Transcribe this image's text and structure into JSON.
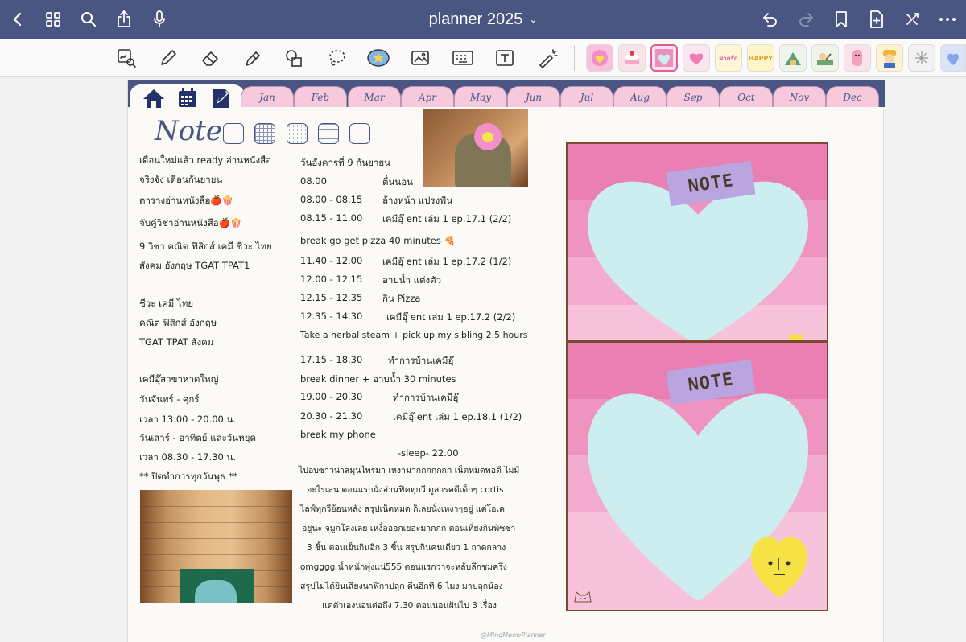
{
  "app": {
    "title": "planner 2025"
  },
  "colors": {
    "topbar": "#4a5682",
    "tab_pink": "#f6c9dd",
    "note_pink": "#e982b5",
    "heart_blue": "#cdeef0",
    "label_purple": "#b9a6e0"
  },
  "topbar": {
    "left_icons": [
      "back-icon",
      "grid-icon",
      "search-icon",
      "share-icon",
      "microphone-icon"
    ],
    "right_icons": [
      "undo-icon",
      "redo-icon",
      "bookmark-icon",
      "add-page-icon",
      "close-toolbar-icon",
      "more-icon"
    ]
  },
  "toolbar": {
    "tools": [
      "zoom-window-icon",
      "pen-icon",
      "eraser-icon",
      "highlighter-icon",
      "shapes-icon",
      "lasso-icon",
      "sticker-icon",
      "image-icon",
      "keyboard-icon",
      "text-box-icon",
      "laser-pointer-icon"
    ],
    "stickers": [
      "pink heart sticker",
      "cake sticker",
      "note card sticker",
      "heart sticker",
      "rak sticker",
      "happy sticker",
      "camping sticker",
      "picnic sticker",
      "bear sticker",
      "mascot sticker",
      "sparkle sticker",
      "blue heart sticker"
    ]
  },
  "tabs": {
    "months": [
      "Jan",
      "Feb",
      "Mar",
      "Apr",
      "May",
      "Jun",
      "Jul",
      "Aug",
      "Sep",
      "Oct",
      "Nov",
      "Dec"
    ],
    "home_icons": [
      "home-icon",
      "calendar-icon",
      "notebook-icon"
    ]
  },
  "note": {
    "heading": "Note",
    "templates": [
      "blank",
      "grid",
      "dotted",
      "grid",
      "lined",
      "blank"
    ]
  },
  "left_column": [
    "เดือนใหม่แล้ว ready อ่านหนังสือ",
    "จริงจัง เดือนกันยายน",
    "ตารางอ่านหนังสือ🍎🍿",
    "จับคู่วิชาอ่านหนังสือ🍎🍿",
    "9 วิชา คณิต ฟิสิกส์ เคมี ชีวะ ไทย",
    "สังคม อังกฤษ TGAT TPAT1",
    "",
    "ชีวะ เคมี ไทย",
    "คณิต ฟิสิกส์ อังกฤษ",
    "TGAT TPAT สังคม",
    "",
    "เคมีอุ๊สาขาหาดใหญ่",
    "วันจันทร์ - ศุกร์",
    "เวลา 13.00 - 20.00 น.",
    "วันเสาร์ - อาทิตย์ และวันหยุด",
    "เวลา 08.30 - 17.30 น.",
    "** ปิดทำการทุกวันพุธ **"
  ],
  "schedule": {
    "date": "วันอังคารที่ 9 กันยายน",
    "rows": [
      {
        "time": "08.00",
        "activity": "ตื่นนอน"
      },
      {
        "time": "08.00 - 08.15",
        "activity": "ล้างหน้า แปรงฟัน"
      },
      {
        "time": "08.15 - 11.00",
        "activity": "เคมีอุ๊ ent เล่ม 1 ep.17.1 (2/2)"
      },
      {
        "time": "",
        "activity": "break go get pizza  40 minutes 🍕"
      },
      {
        "time": "11.40 - 12.00",
        "activity": "เคมีอุ๊ ent เล่ม 1 ep.17.2 (1/2)"
      },
      {
        "time": "12.00 - 12.15",
        "activity": "อาบน้ำ แต่งตัว"
      },
      {
        "time": "12.15 - 12.35",
        "activity": "กิน Pizza"
      },
      {
        "time": "12.35 - 14.30",
        "activity": "เคมีอุ๊ ent เล่ม 1 ep.17.2 (2/2)"
      },
      {
        "time": "",
        "activity": "Take a herbal steam + pick up my sibling 2.5 hours"
      },
      {
        "time": "17.15 - 18.30",
        "activity": "ทำการบ้านเคมีอุ๊"
      },
      {
        "time": "",
        "activity": "break dinner + อาบน้ำ 30 minutes"
      },
      {
        "time": "19.00 - 20.30",
        "activity": "ทำการบ้านเคมีอุ๊"
      },
      {
        "time": "20.30 - 21.30",
        "activity": "เคมีอุ๊ ent เล่ม 1 ep.18.1 (1/2)"
      },
      {
        "time": "",
        "activity": "break my phone"
      }
    ],
    "sleep": "-sleep- 22.00"
  },
  "diary": [
    "ไปอบซาวน่าสมุนไพรมา เหงามากกกกกกก เน็ตหมดพอดี ไม่มี",
    "อะไรเล่น ตอนแรกนั่งอ่านฟิคทุกวี ดูสารคดีเด็กๆ cortis",
    "ไลฟ์ทุกวีย้อนหลัง สรุปเน็ตหมด ก็เลยนั่งเหงาๆอยู่ แต่โอเค",
    "อยู่นะ จมูกโล่งเลย เหงื่อออกเยอะมากกก ตอนเที่ยงกินพิซซ่า",
    "3 ชิ้น ตอนเย็นกินอีก 3 ชิ้น สรุปกินคนเดียว 1 ถาดกลาง",
    "omgggg น้ำหนักพุ่งแน่555 ตอนแรกว่าจะหลับลึกชมครึ่ง",
    "สรุปไม่ได้ยินเสียงนาฬิกาปลุก ตื่นอีกที 6 โมง มาปลุกน้อง",
    "แต่ตัวเองนอนต่อถึง 7.30 ตอนนอนฝันไป 3 เรื่อง"
  ],
  "notecards": [
    {
      "label": "NOTE"
    },
    {
      "label": "NOTE"
    }
  ],
  "watermark": "@MindMeowPlanner"
}
